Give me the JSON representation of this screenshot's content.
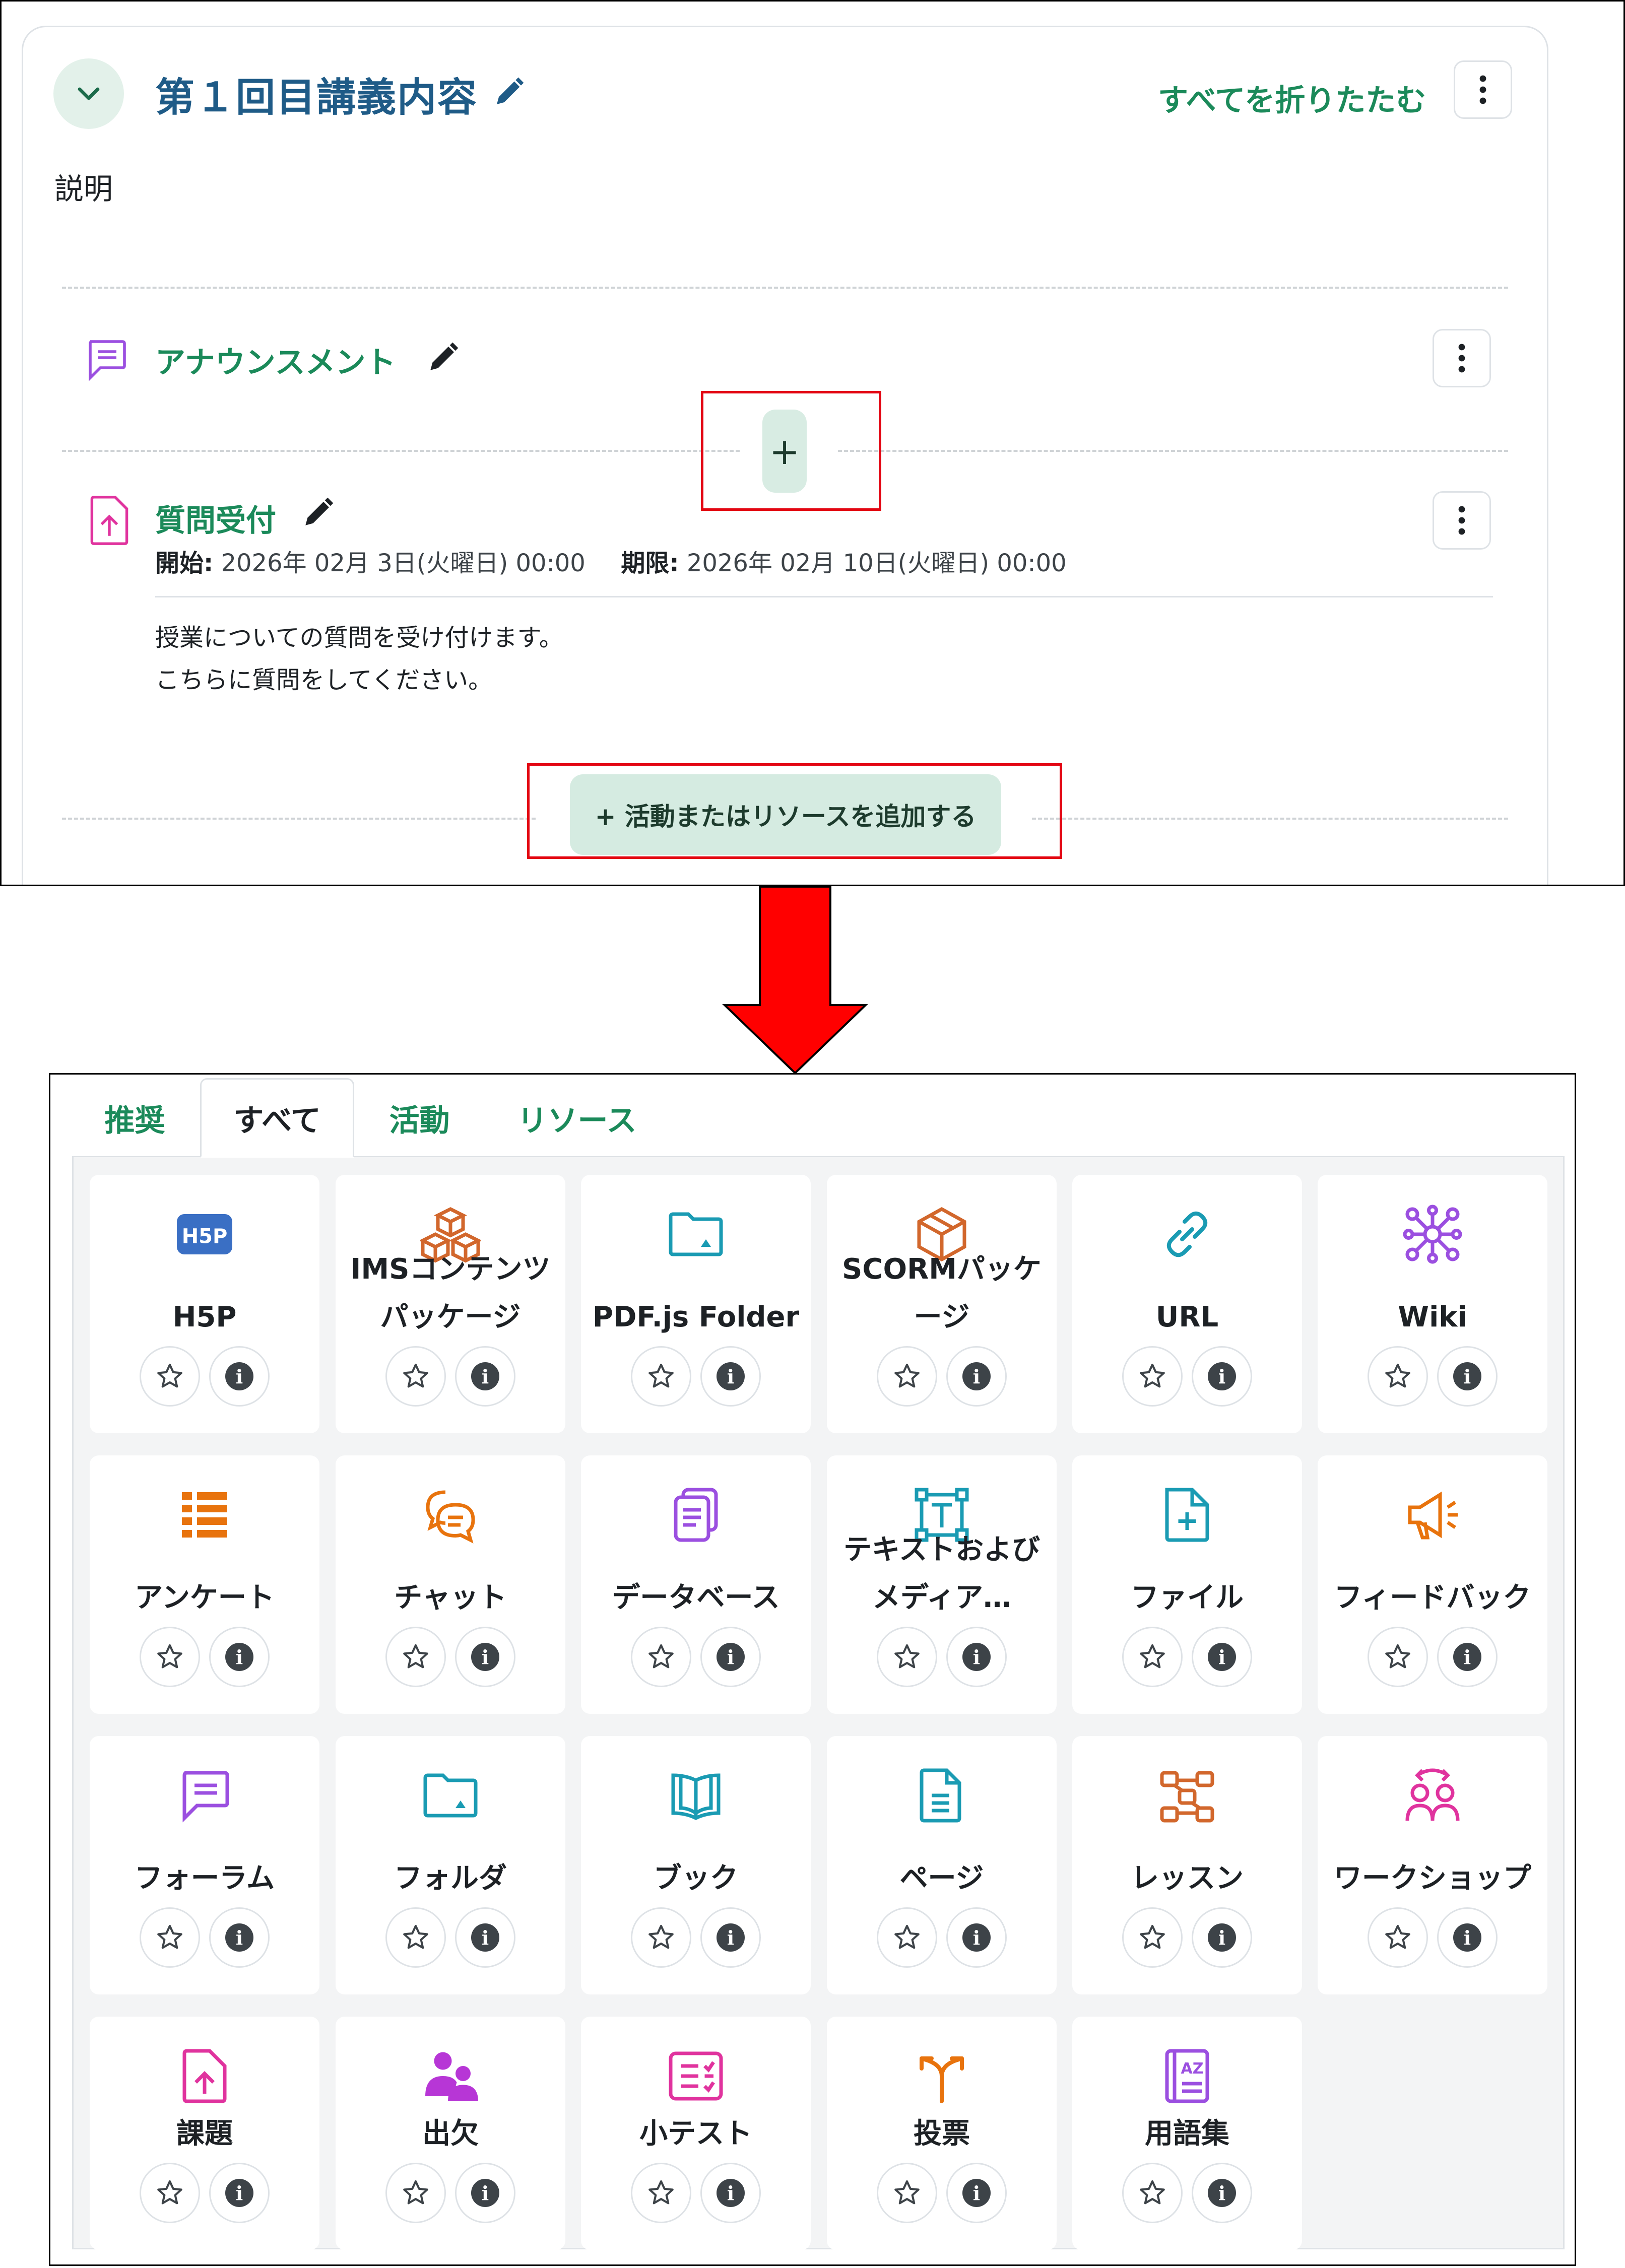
{
  "section": {
    "title": "第１回目講義内容",
    "collapse_all": "すべてを折りたたむ",
    "description": "説明"
  },
  "activities": [
    {
      "title": "アナウンスメント"
    },
    {
      "title": "質問受付",
      "start_label": "開始:",
      "start_value": "2026年 02月 3日(火曜日) 00:00",
      "due_label": "期限:",
      "due_value": "2026年 02月 10日(火曜日) 00:00",
      "desc_line1": "授業についての質問を受け付けます。",
      "desc_line2": "こちらに質問をしてください。"
    }
  ],
  "add_inline": "+",
  "add_activity_button": "+ 活動またはリソースを追加する",
  "chooser": {
    "tabs": [
      "推奨",
      "すべて",
      "活動",
      "リソース"
    ],
    "active_tab": "すべて",
    "modules": [
      {
        "name": "H5P",
        "icon": "h5p-icon",
        "color": "#3a6fc4"
      },
      {
        "name": "IMSコンテンツパッケージ",
        "icon": "package-icon",
        "color": "#d2672c"
      },
      {
        "name": "PDF.js Folder",
        "icon": "folder-icon",
        "color": "#1a9bb3"
      },
      {
        "name": "SCORMパッケージ",
        "icon": "box-icon",
        "color": "#d2672c"
      },
      {
        "name": "URL",
        "icon": "link-icon",
        "color": "#1a9bb3"
      },
      {
        "name": "Wiki",
        "icon": "network-icon",
        "color": "#9b4fe0"
      },
      {
        "name": "アンケート",
        "icon": "survey-icon",
        "color": "#e8730d"
      },
      {
        "name": "チャット",
        "icon": "chat-icon",
        "color": "#e8730d"
      },
      {
        "name": "データベース",
        "icon": "database-icon",
        "color": "#9b4fe0"
      },
      {
        "name": "テキストおよびメディア…",
        "icon": "text-media-icon",
        "color": "#1a9bb3"
      },
      {
        "name": "ファイル",
        "icon": "file-icon",
        "color": "#1a9bb3"
      },
      {
        "name": "フィードバック",
        "icon": "megaphone-icon",
        "color": "#e8730d"
      },
      {
        "name": "フォーラム",
        "icon": "forum-icon",
        "color": "#9b4fe0"
      },
      {
        "name": "フォルダ",
        "icon": "folder-icon",
        "color": "#1a9bb3"
      },
      {
        "name": "ブック",
        "icon": "book-icon",
        "color": "#1a9bb3"
      },
      {
        "name": "ページ",
        "icon": "page-icon",
        "color": "#1a9bb3"
      },
      {
        "name": "レッスン",
        "icon": "lesson-icon",
        "color": "#d2672c"
      },
      {
        "name": "ワークショップ",
        "icon": "workshop-icon",
        "color": "#e0339e"
      },
      {
        "name": "課題",
        "icon": "assignment-icon",
        "color": "#e0339e"
      },
      {
        "name": "出欠",
        "icon": "attendance-icon",
        "color": "#b736d6"
      },
      {
        "name": "小テスト",
        "icon": "quiz-icon",
        "color": "#e0339e"
      },
      {
        "name": "投票",
        "icon": "choice-icon",
        "color": "#e8730d"
      },
      {
        "name": "用語集",
        "icon": "glossary-icon",
        "color": "#9b4fe0"
      }
    ],
    "info_glyph": "i"
  }
}
